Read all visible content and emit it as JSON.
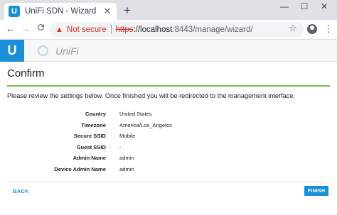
{
  "browser": {
    "tab_title": "UniFi SDN - Wizard",
    "tab_favicon_letter": "U",
    "tab_close": "✕",
    "new_tab": "+",
    "window_controls": {
      "minimize": "—",
      "maximize": "☐",
      "close": "✕"
    },
    "nav": {
      "back": "←",
      "forward": "→",
      "reload": "C"
    },
    "security_warning": "Not secure",
    "url_scheme": "https",
    "url_host": "://localhost",
    "url_rest": ":8443/manage/wizard/",
    "star": "☆",
    "menu": "⋮"
  },
  "app_header": {
    "brand_letter": "U",
    "wordmark": "UniFi"
  },
  "wizard": {
    "title": "Confirm",
    "instructions": "Please review the settings below. Once finished you will be redirected to the management interface.",
    "fields": [
      {
        "label": "Country",
        "value": "United States"
      },
      {
        "label": "Timezone",
        "value": "America/Los_Angeles"
      },
      {
        "label": "Secure SSID",
        "value": "Mobile"
      },
      {
        "label": "Guest SSID",
        "value": "-"
      },
      {
        "label": "Admin Name",
        "value": "admin"
      },
      {
        "label": "Device Admin Name",
        "value": "admin"
      }
    ],
    "back_label": "BACK",
    "finish_label": "FINISH"
  },
  "colors": {
    "accent": "#1a8fd8",
    "progress": "#76c043",
    "warning": "#d93025"
  }
}
